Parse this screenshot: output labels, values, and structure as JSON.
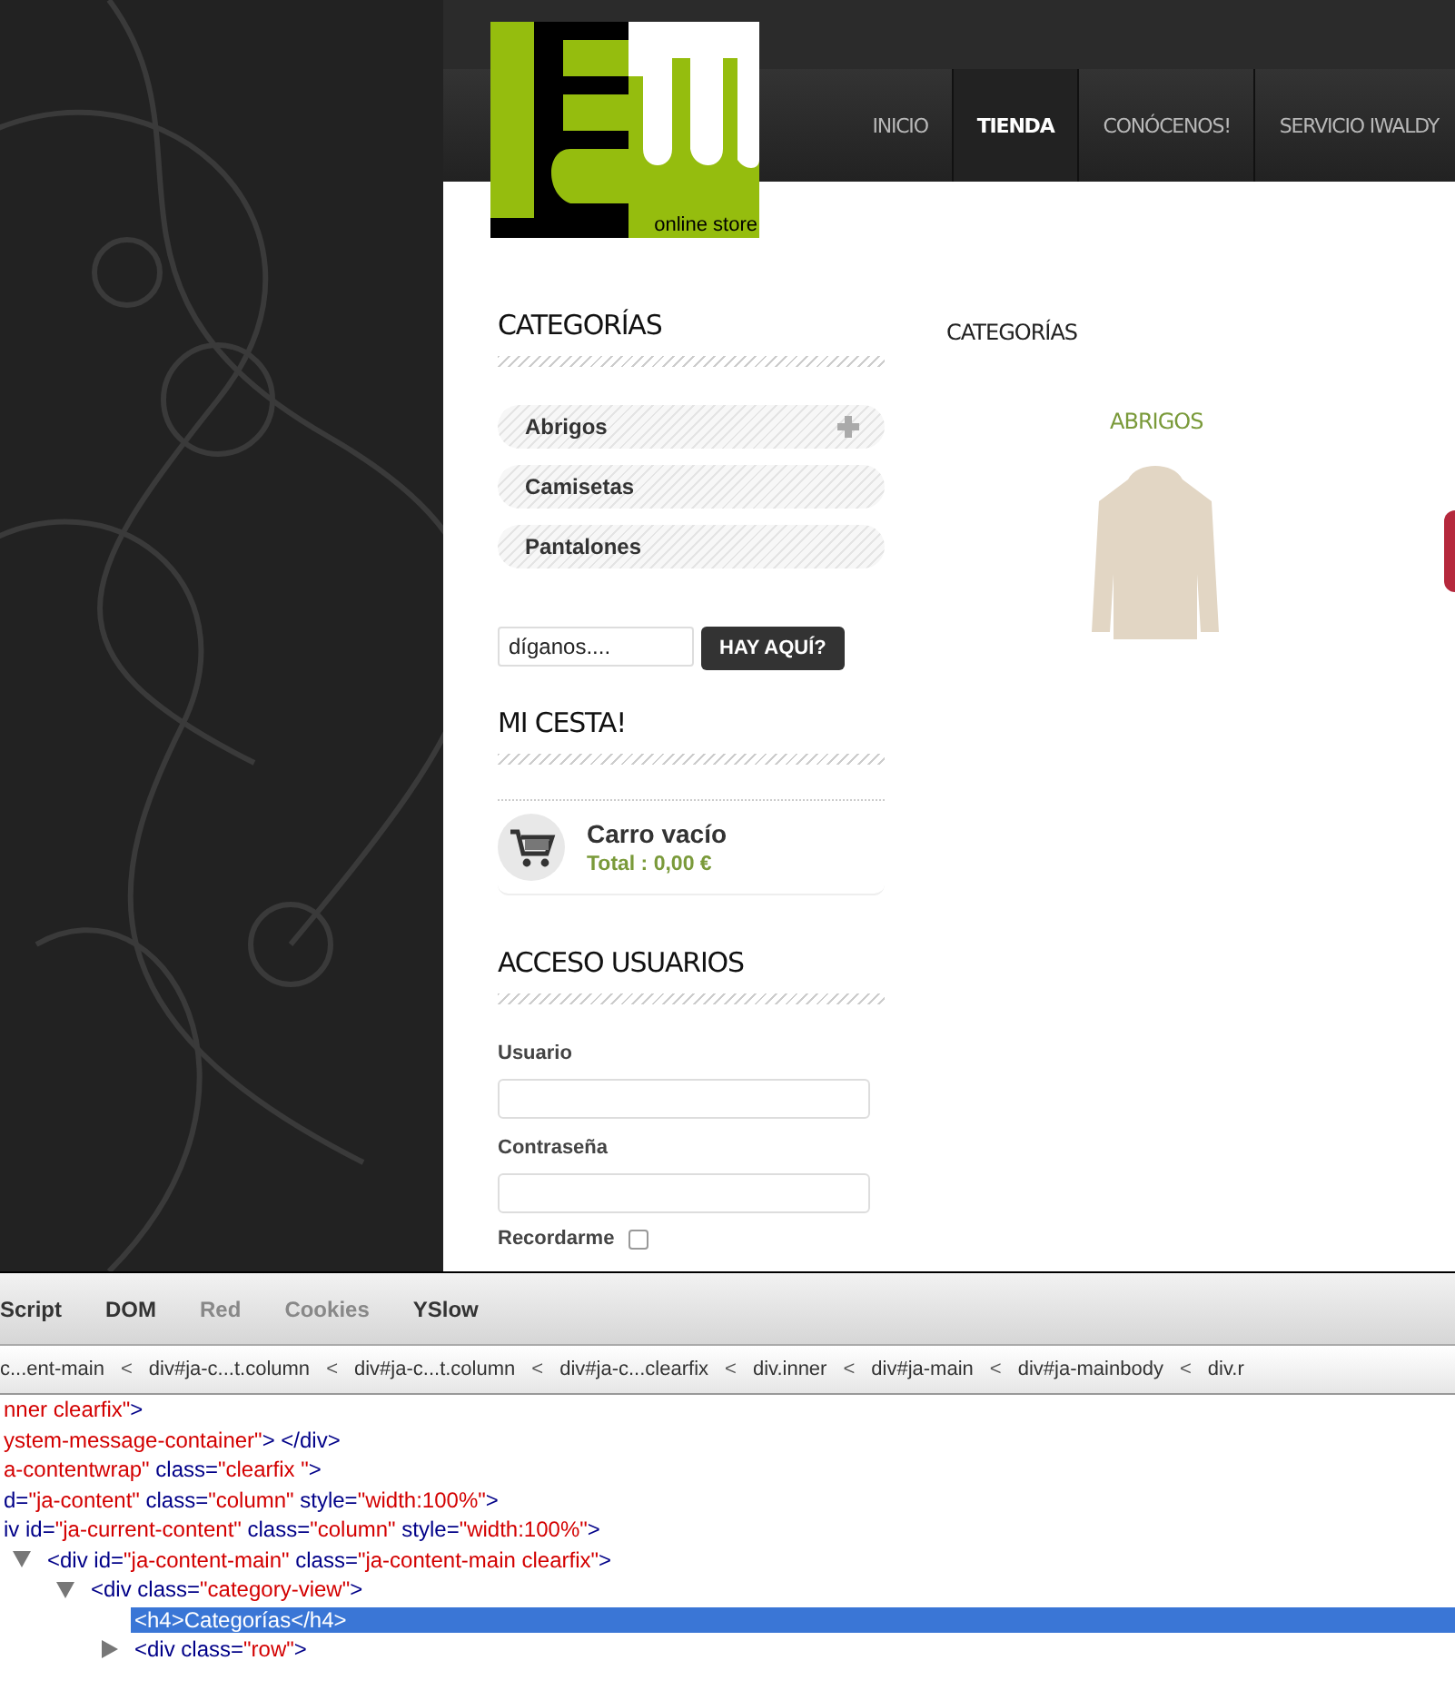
{
  "logo": {
    "caption": "online store"
  },
  "nav": [
    {
      "label": "INICIO",
      "selected": false
    },
    {
      "label": "TIENDA",
      "selected": true
    },
    {
      "label": "CONÓCENOS!",
      "selected": false
    },
    {
      "label": "SERVICIO IWALDY",
      "selected": false
    }
  ],
  "sidebar": {
    "categories_title": "CATEGORÍAS",
    "categories": [
      {
        "label": "Abrigos",
        "has_children": true
      },
      {
        "label": "Camisetas",
        "has_children": false
      },
      {
        "label": "Pantalones",
        "has_children": false
      }
    ],
    "search": {
      "placeholder": "díganos....",
      "button": "HAY AQUÍ?"
    },
    "cart": {
      "title": "MI CESTA!",
      "status": "Carro vacío",
      "total": "Total : 0,00 €"
    },
    "login": {
      "title": "ACCESO USUARIOS",
      "fields": [
        {
          "label": "Usuario"
        },
        {
          "label": "Contraseña"
        }
      ],
      "remember": {
        "label": "Recordarme",
        "checked": false
      }
    }
  },
  "content": {
    "title": "CATEGORÍAS",
    "category": {
      "name": "ABRIGOS"
    }
  },
  "devtools": {
    "tabs": [
      {
        "label": "Script",
        "disabled": false
      },
      {
        "label": "DOM",
        "disabled": false
      },
      {
        "label": "Red",
        "disabled": true
      },
      {
        "label": "Cookies",
        "disabled": true
      },
      {
        "label": "YSlow",
        "disabled": false
      }
    ],
    "breadcrumbs": [
      {
        "label": "c...ent-main"
      },
      {
        "separator": "<",
        "label": "div#ja-c...t.column"
      },
      {
        "separator": "<",
        "label": "div#ja-c...t.column"
      },
      {
        "separator": "<",
        "label": "div#ja-c...clearfix"
      },
      {
        "separator": "<",
        "label": "div.inner"
      },
      {
        "separator": "<",
        "label": "div#ja-main"
      },
      {
        "separator": "<",
        "label": "div#ja-mainbody"
      },
      {
        "separator": "<",
        "label": "div.r"
      }
    ],
    "lines": [
      {
        "selected": false,
        "segments": [
          {
            "kind": "value",
            "text": "nner clearfix\""
          },
          {
            "kind": "markup",
            "text": ">"
          }
        ]
      },
      {
        "selected": false,
        "segments": [
          {
            "kind": "value",
            "text": "ystem-message-container\""
          },
          {
            "kind": "markup",
            "text": ">  </div>"
          }
        ]
      },
      {
        "selected": false,
        "segments": [
          {
            "kind": "value",
            "text": "a-contentwrap\""
          },
          {
            "kind": "markup",
            "text": " class="
          },
          {
            "kind": "value",
            "text": "\"clearfix \""
          },
          {
            "kind": "markup",
            "text": ">"
          }
        ]
      },
      {
        "selected": false,
        "segments": [
          {
            "kind": "markup",
            "text": "d="
          },
          {
            "kind": "value",
            "text": "\"ja-content\""
          },
          {
            "kind": "markup",
            "text": " class="
          },
          {
            "kind": "value",
            "text": "\"column\""
          },
          {
            "kind": "markup",
            "text": " style="
          },
          {
            "kind": "value",
            "text": "\"width:100%\""
          },
          {
            "kind": "markup",
            "text": ">"
          }
        ]
      },
      {
        "selected": false,
        "segments": [
          {
            "kind": "markup",
            "text": "iv id="
          },
          {
            "kind": "value",
            "text": "\"ja-current-content\""
          },
          {
            "kind": "markup",
            "text": " class="
          },
          {
            "kind": "value",
            "text": "\"column\""
          },
          {
            "kind": "markup",
            "text": " style="
          },
          {
            "kind": "value",
            "text": "\"width:100%\""
          },
          {
            "kind": "markup",
            "text": ">"
          }
        ]
      },
      {
        "selected": false,
        "expanded": true,
        "segments": [
          {
            "kind": "markup",
            "text": "<div id="
          },
          {
            "kind": "value",
            "text": "\"ja-content-main\""
          },
          {
            "kind": "markup",
            "text": " class="
          },
          {
            "kind": "value",
            "text": "\"ja-content-main clearfix\""
          },
          {
            "kind": "markup",
            "text": ">"
          }
        ],
        "children": [
          {
            "selected": false,
            "expanded": true,
            "segments": [
              {
                "kind": "markup",
                "text": "<div class="
              },
              {
                "kind": "value",
                "text": "\"category-view\""
              },
              {
                "kind": "markup",
                "text": ">"
              }
            ],
            "children": [
              {
                "selected": true,
                "segments": [
                  {
                    "kind": "markup",
                    "text": "<h4>Categorías</h4>"
                  }
                ]
              },
              {
                "selected": false,
                "expanded": false,
                "segments": [
                  {
                    "kind": "markup",
                    "text": "<div class="
                  },
                  {
                    "kind": "value",
                    "text": "\"row\""
                  },
                  {
                    "kind": "markup",
                    "text": ">"
                  }
                ]
              }
            ]
          }
        ]
      }
    ]
  }
}
